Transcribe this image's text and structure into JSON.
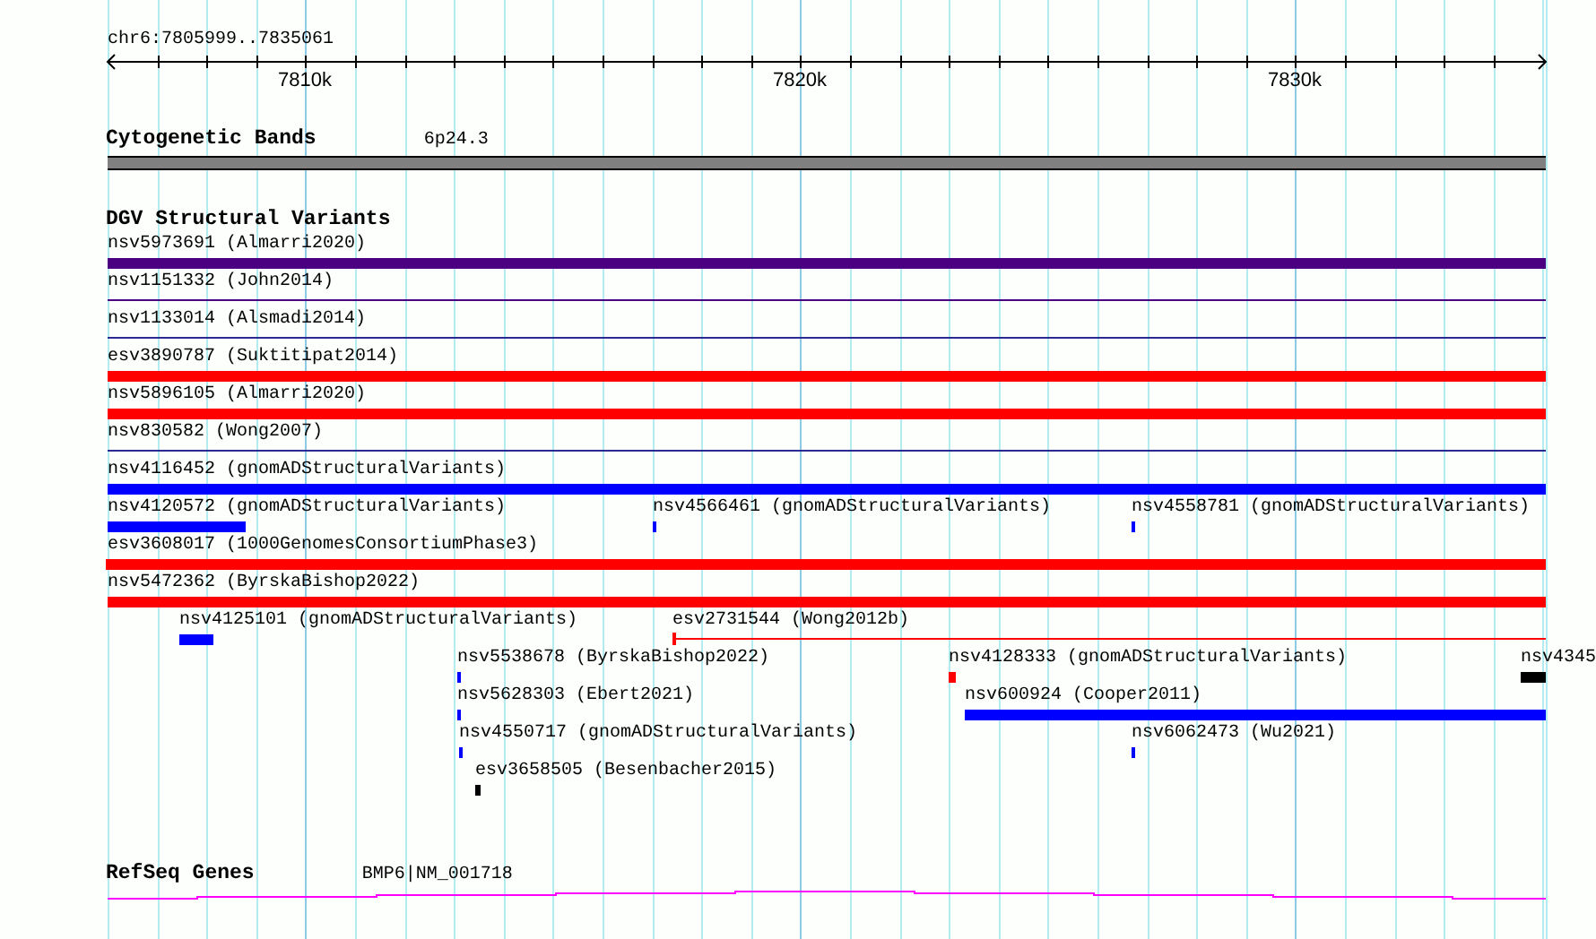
{
  "locus": "chr6:7805999..7835061",
  "ruler": {
    "labels": [
      "7810k",
      "7820k",
      "7830k"
    ]
  },
  "cytogenetic_bands": {
    "title": "Cytogenetic Bands",
    "band": {
      "label": "6p24.3"
    }
  },
  "dgv_track": {
    "title": "DGV Structural Variants",
    "rows": [
      {
        "features": [
          {
            "label": "nsv5973691 (Almarri2020)",
            "kind": "bar",
            "color": "#4b0082"
          }
        ]
      },
      {
        "features": [
          {
            "label": "nsv1151332 (John2014)",
            "kind": "line",
            "color": "#4b0082"
          }
        ]
      },
      {
        "features": [
          {
            "label": "nsv1133014 (Alsmadi2014)",
            "kind": "line",
            "color": "#2a2a90"
          }
        ]
      },
      {
        "features": [
          {
            "label": "esv3890787 (Suktitipat2014)",
            "kind": "bar",
            "color": "#ff0000"
          }
        ]
      },
      {
        "features": [
          {
            "label": "nsv5896105 (Almarri2020)",
            "kind": "bar",
            "color": "#ff0000"
          }
        ]
      },
      {
        "features": [
          {
            "label": "nsv830582 (Wong2007)",
            "kind": "line",
            "color": "#2a2a90"
          }
        ]
      },
      {
        "features": [
          {
            "label": "nsv4116452 (gnomADStructuralVariants)",
            "kind": "bar",
            "color": "#0000ff"
          }
        ]
      },
      {
        "features": [
          {
            "label": "nsv4120572 (gnomADStructuralVariants)",
            "kind": "bar",
            "color": "#0000ff"
          },
          {
            "label": "nsv4566461 (gnomADStructuralVariants)",
            "kind": "bar",
            "color": "#0000ff"
          },
          {
            "label": "nsv4558781 (gnomADStructuralVariants)",
            "kind": "bar",
            "color": "#0000ff"
          }
        ]
      },
      {
        "features": [
          {
            "label": "esv3608017 (1000GenomesConsortiumPhase3)",
            "kind": "bar",
            "color": "#ff0000"
          }
        ]
      },
      {
        "features": [
          {
            "label": "nsv5472362 (ByrskaBishop2022)",
            "kind": "bar",
            "color": "#ff0000"
          }
        ]
      },
      {
        "features": [
          {
            "label": "nsv4125101 (gnomADStructuralVariants)",
            "kind": "bar",
            "color": "#0000ff"
          },
          {
            "label": "esv2731544 (Wong2012b)",
            "kind": "capped-line",
            "color": "#ff0000"
          }
        ]
      },
      {
        "features": [
          {
            "label": "nsv5538678 (ByrskaBishop2022)",
            "kind": "bar",
            "color": "#0000ff"
          },
          {
            "label": "nsv4128333 (gnomADStructuralVariants)",
            "kind": "bar",
            "color": "#ff0000"
          },
          {
            "label": "nsv4345",
            "kind": "bar",
            "color": "#000000"
          }
        ]
      },
      {
        "features": [
          {
            "label": "nsv5628303 (Ebert2021)",
            "kind": "bar",
            "color": "#0000ff"
          },
          {
            "label": "nsv600924 (Cooper2011)",
            "kind": "bar",
            "color": "#0000ff"
          }
        ]
      },
      {
        "features": [
          {
            "label": "nsv4550717 (gnomADStructuralVariants)",
            "kind": "bar",
            "color": "#0000ff"
          },
          {
            "label": "nsv6062473 (Wu2021)",
            "kind": "bar",
            "color": "#0000ff"
          }
        ]
      },
      {
        "features": [
          {
            "label": "esv3658505 (Besenbacher2015)",
            "kind": "bar",
            "color": "#000000"
          }
        ]
      }
    ]
  },
  "refseq_genes": {
    "title": "RefSeq Genes",
    "gene": {
      "label": "BMP6|NM_001718"
    }
  }
}
